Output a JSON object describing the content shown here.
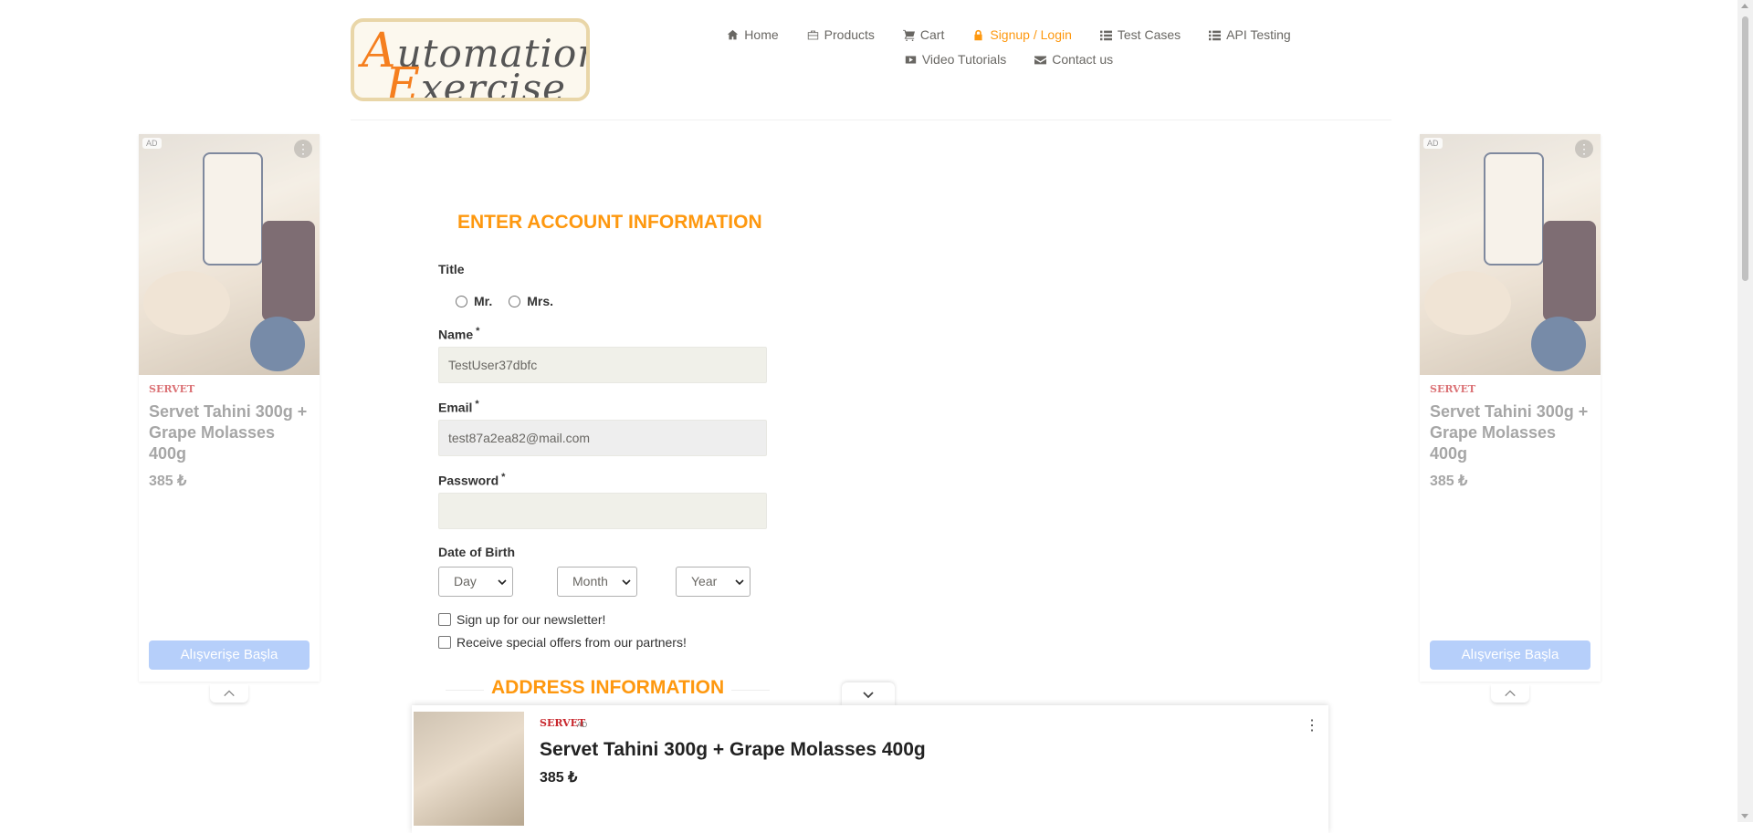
{
  "header": {
    "logo_line1": "Automation",
    "logo_line2": "Exercise",
    "nav": [
      {
        "label": "Home",
        "icon": "home-icon"
      },
      {
        "label": "Products",
        "icon": "products-icon"
      },
      {
        "label": "Cart",
        "icon": "cart-icon"
      },
      {
        "label": "Signup / Login",
        "icon": "lock-icon",
        "active": true
      },
      {
        "label": "Test Cases",
        "icon": "list-icon"
      },
      {
        "label": "API Testing",
        "icon": "list-icon"
      },
      {
        "label": "Video Tutorials",
        "icon": "youtube-icon"
      },
      {
        "label": "Contact us",
        "icon": "envelope-icon"
      }
    ],
    "active_color": "#fe980f"
  },
  "form": {
    "title": "ENTER ACCOUNT INFORMATION",
    "title_label": "Title",
    "title_options": [
      "Mr.",
      "Mrs."
    ],
    "name_label": "Name",
    "name_value": "TestUser37dbfc",
    "email_label": "Email",
    "email_value": "test87a2ea82@mail.com",
    "password_label": "Password",
    "password_value": "",
    "required_mark": "*",
    "dob_label": "Date of Birth",
    "dob_day": "Day",
    "dob_month": "Month",
    "dob_year": "Year",
    "newsletter_label": "Sign up for our newsletter!",
    "offers_label": "Receive special offers from our partners!",
    "address_title": "ADDRESS INFORMATION"
  },
  "ads": {
    "badge": "AD",
    "brand": "SERVET",
    "title": "Servet Tahini 300g + Grape Molasses 400g",
    "price": "385 ₺",
    "cta": "Alışverişe Başla",
    "bottom_badge": "AD"
  }
}
